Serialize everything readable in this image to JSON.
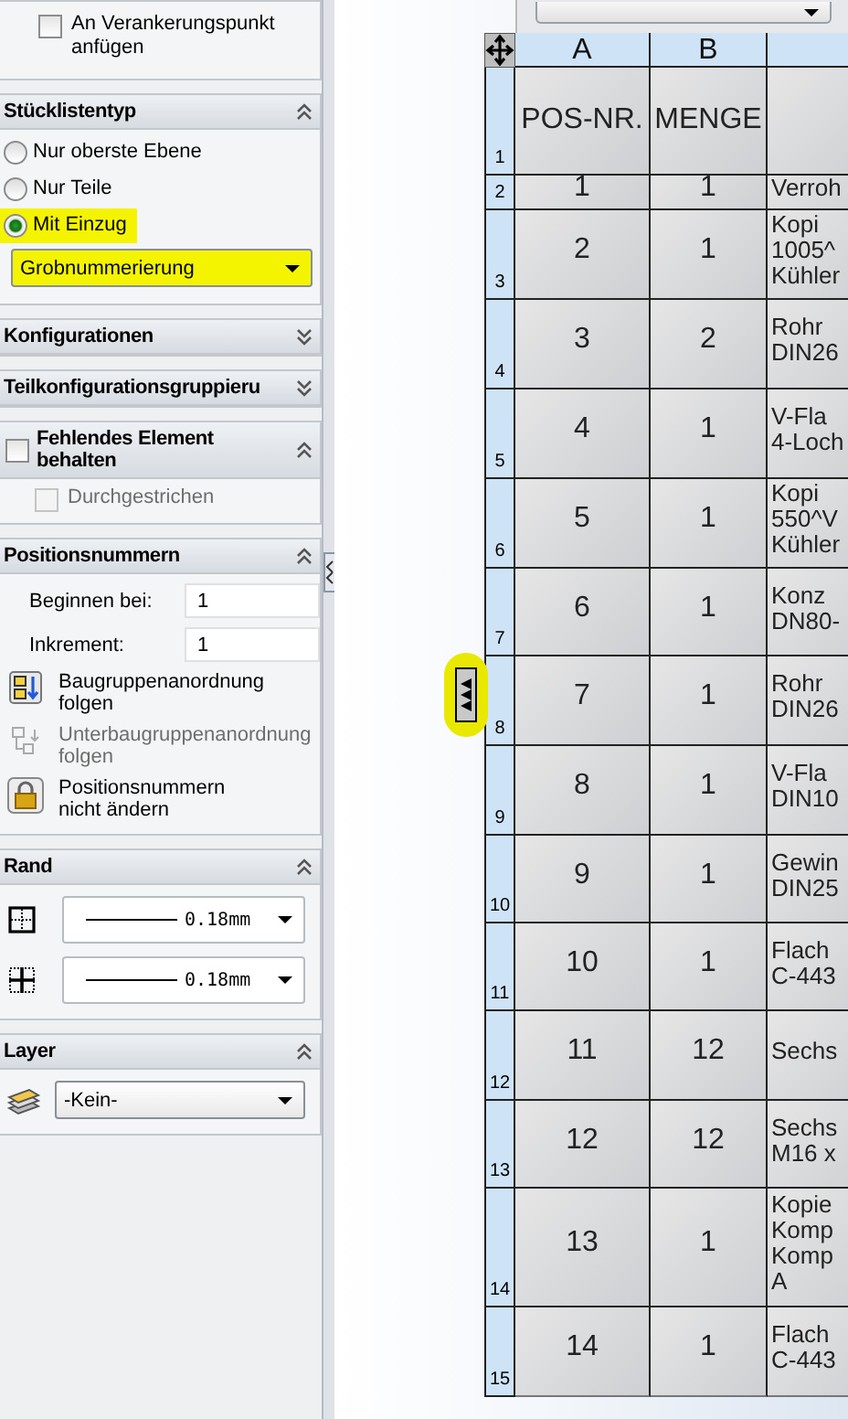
{
  "panel": {
    "groups": [
      {
        "kind": "plain",
        "items": [
          {
            "kind": "checkbox",
            "label": "An Verankerungspunkt\nanfügen",
            "checked": false,
            "disabled": false
          }
        ]
      },
      {
        "kind": "section",
        "title": "Stücklistentyp",
        "expanded": true,
        "items": [
          {
            "kind": "radio",
            "label": "Nur oberste Ebene",
            "selected": false,
            "highlighted": false
          },
          {
            "kind": "radio",
            "label": "Nur Teile",
            "selected": false,
            "highlighted": false
          },
          {
            "kind": "radio",
            "label": "Mit Einzug",
            "selected": true,
            "highlighted": true
          },
          {
            "kind": "dropdown",
            "value": "Grobnummerierung",
            "highlighted": true
          }
        ]
      },
      {
        "kind": "section",
        "title": "Konfigurationen",
        "expanded": false
      },
      {
        "kind": "section",
        "title": "Teilkonfigurationsgruppieru",
        "expanded": false
      },
      {
        "kind": "check-section",
        "title": "Fehlendes Element\nbehalten",
        "checked": false,
        "expanded": true,
        "items": [
          {
            "kind": "checkbox",
            "label": "Durchgestrichen",
            "checked": false,
            "disabled": true
          }
        ]
      },
      {
        "kind": "section",
        "title": "Positionsnummern",
        "expanded": true,
        "items": [
          {
            "kind": "number",
            "label": "Beginnen bei:",
            "value": "1"
          },
          {
            "kind": "number",
            "label": "Inkrement:",
            "value": "1"
          },
          {
            "kind": "tool",
            "label": "Baugruppenanordnung\nfolgen",
            "disabled": false
          },
          {
            "kind": "tool",
            "label": "Unterbaugruppenanordnung\nfolgen",
            "disabled": true
          },
          {
            "kind": "tool",
            "label": "Positionsnummern\nnicht ändern",
            "disabled": false
          }
        ]
      },
      {
        "kind": "section",
        "title": "Rand",
        "expanded": true,
        "items": [
          {
            "kind": "line",
            "value": "0.18mm"
          },
          {
            "kind": "line",
            "value": "0.18mm"
          }
        ]
      },
      {
        "kind": "section",
        "title": "Layer",
        "expanded": true,
        "items": [
          {
            "kind": "layer",
            "value": "-Kein-"
          }
        ]
      }
    ]
  },
  "table": {
    "columns": [
      "A",
      "B"
    ],
    "rows": [
      {
        "number": "1",
        "cells": [
          "POS-NR.",
          "MENGE"
        ],
        "highlighted": false
      },
      {
        "number": "2",
        "cells": [
          "1",
          "1",
          "Verroh"
        ],
        "highlighted": false
      },
      {
        "number": "3",
        "cells": [
          "2",
          "1",
          "Kopi\n1005^\nKühler"
        ],
        "highlighted": false
      },
      {
        "number": "4",
        "cells": [
          "3",
          "2",
          "Rohr\nDIN26"
        ],
        "highlighted": false
      },
      {
        "number": "5",
        "cells": [
          "4",
          "1",
          "V-Fla\n4-Loch"
        ],
        "highlighted": false
      },
      {
        "number": "6",
        "cells": [
          "5",
          "1",
          "Kopi\n550^V\nKühler"
        ],
        "highlighted": false
      },
      {
        "number": "7",
        "cells": [
          "6",
          "1",
          "Konz\nDN80-"
        ],
        "highlighted": false
      },
      {
        "number": "8",
        "cells": [
          "7",
          "1",
          "Rohr\nDIN26"
        ],
        "highlighted": true
      },
      {
        "number": "9",
        "cells": [
          "8",
          "1",
          "V-Fla\nDIN10"
        ],
        "highlighted": false
      },
      {
        "number": "10",
        "cells": [
          "9",
          "1",
          "Gewin\nDIN25"
        ],
        "highlighted": false
      },
      {
        "number": "11",
        "cells": [
          "10",
          "1",
          "Flach\nC-443"
        ],
        "highlighted": false
      },
      {
        "number": "12",
        "cells": [
          "11",
          "12",
          "Sechs"
        ],
        "highlighted": false
      },
      {
        "number": "13",
        "cells": [
          "12",
          "12",
          "Sechs\nM16 x"
        ],
        "highlighted": false
      },
      {
        "number": "14",
        "cells": [
          "13",
          "1",
          "Kopie\nKomp\nKomp\nA"
        ],
        "highlighted": false
      },
      {
        "number": "15",
        "cells": [
          "14",
          "1",
          "Flach\nC-443"
        ],
        "highlighted": false
      }
    ]
  }
}
